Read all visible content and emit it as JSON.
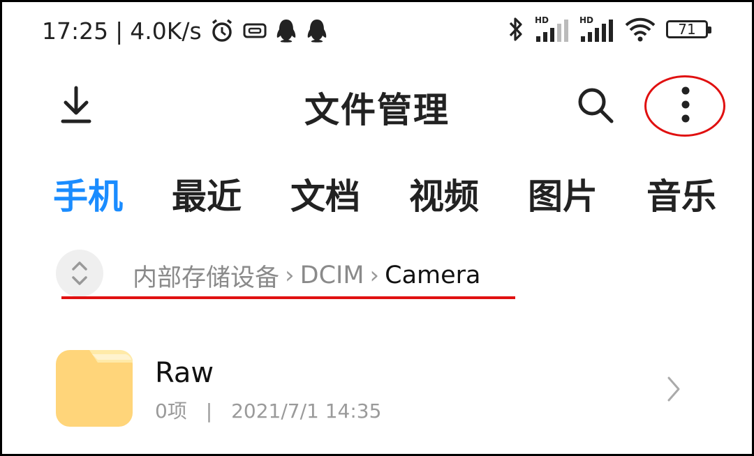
{
  "status_bar": {
    "time": "17:25",
    "separator": "|",
    "network_speed": "4.0K/s",
    "left_icons": [
      "alarm-icon",
      "screen-record-icon",
      "qq-icon",
      "qq-icon"
    ],
    "right_icons": [
      "bluetooth-icon",
      "hd-signal-icon",
      "hd-signal-icon",
      "wifi-icon"
    ],
    "hd_label": "HD",
    "battery_level": "71"
  },
  "header": {
    "title": "文件管理",
    "left_icon": "download-icon",
    "right_icons": [
      "search-icon",
      "more-vert-icon"
    ],
    "annotation_color": "#e01010"
  },
  "tabs": [
    {
      "label": "手机",
      "active": true
    },
    {
      "label": "最近",
      "active": false
    },
    {
      "label": "文档",
      "active": false
    },
    {
      "label": "视频",
      "active": false
    },
    {
      "label": "图片",
      "active": false
    },
    {
      "label": "音乐",
      "active": false
    }
  ],
  "breadcrumb": {
    "toggle_icon": "expand-collapse-icon",
    "items": [
      "内部存储设备",
      "DCIM",
      "Camera"
    ],
    "chevron": "›"
  },
  "files": [
    {
      "name": "Raw",
      "count": "0项",
      "meta_separator": "|",
      "date": "2021/7/1 14:35",
      "icon": "folder-icon",
      "chevron_icon": "chevron-right-icon"
    }
  ],
  "colors": {
    "accent": "#1a8cff",
    "folder": "#ffd57a",
    "annotation": "#e01010"
  }
}
